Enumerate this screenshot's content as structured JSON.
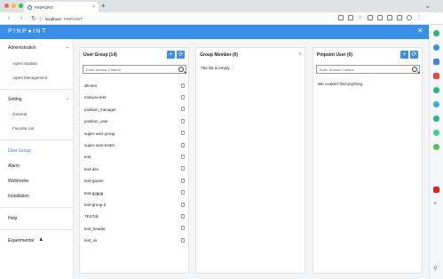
{
  "browser": {
    "tab_title": "PINPOINT",
    "tab_close": "×",
    "new_tab": "+",
    "back": "‹",
    "forward": "›",
    "reload": "↻",
    "host": "localhost",
    "path": "PINPOINT"
  },
  "app": {
    "logo": "PINP●INT",
    "close": "✕"
  },
  "sidebar": {
    "administration": "Administration",
    "agent_statistic": "Agent Statistic",
    "agent_management": "Agent Management",
    "setting": "Setting",
    "general": "General",
    "favorite_list": "Favorite List",
    "user_group": "User Group",
    "alarm": "Alarm",
    "webhooks": "Webhooks",
    "installation": "Installation",
    "help": "Help",
    "experimental": "Experimental",
    "chevron": "⌄"
  },
  "user_group_panel": {
    "title": "User Group (14)",
    "add": "+",
    "refresh": "⟳",
    "search_placeholder": "Enter at least 2 letters",
    "groups": [
      "db-test",
      "minwoo-test",
      "position_manager",
      "position_user",
      "super-user-group",
      "super-user-tester",
      "test",
      "test-dev",
      "test-garam",
      "test-ggggg",
      "test-group-2",
      "TESTdc",
      "test_header",
      "test_ss"
    ]
  },
  "group_member_panel": {
    "title": "Group Member (0)",
    "sort": "⇅",
    "empty": "The list is empty."
  },
  "pinpoint_user_panel": {
    "title": "Pinpoint User (0)",
    "add": "+",
    "refresh": "⟳",
    "search_placeholder": "Enter at least 2 letters",
    "empty": "We couldn't find anything."
  }
}
